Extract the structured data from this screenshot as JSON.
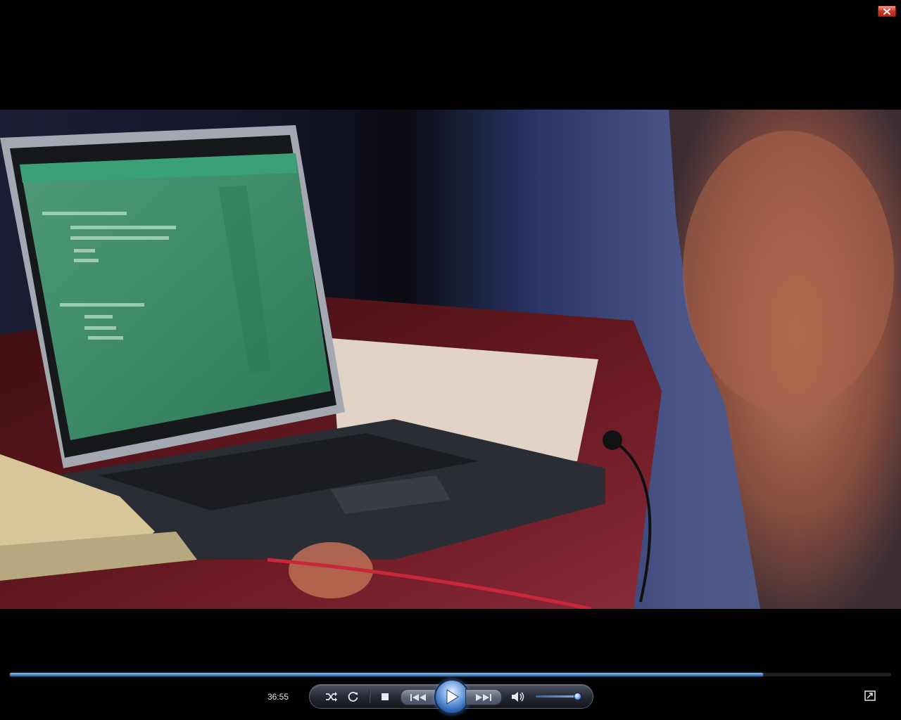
{
  "window": {
    "close_icon": "close-icon"
  },
  "video": {
    "description_icon": "video-frame"
  },
  "transport": {
    "elapsed_time": "36:55",
    "progress_fraction": 0.855,
    "volume_fraction": 0.95
  },
  "buttons": {
    "shuffle_icon": "shuffle-icon",
    "repeat_icon": "repeat-icon",
    "stop_icon": "stop-icon",
    "previous_icon": "previous-icon",
    "play_icon": "play-icon",
    "next_icon": "next-icon",
    "mute_icon": "speaker-icon",
    "fullscreen_icon": "fullscreen-icon"
  },
  "colors": {
    "accent": "#4a82c4",
    "close": "#c83224"
  }
}
